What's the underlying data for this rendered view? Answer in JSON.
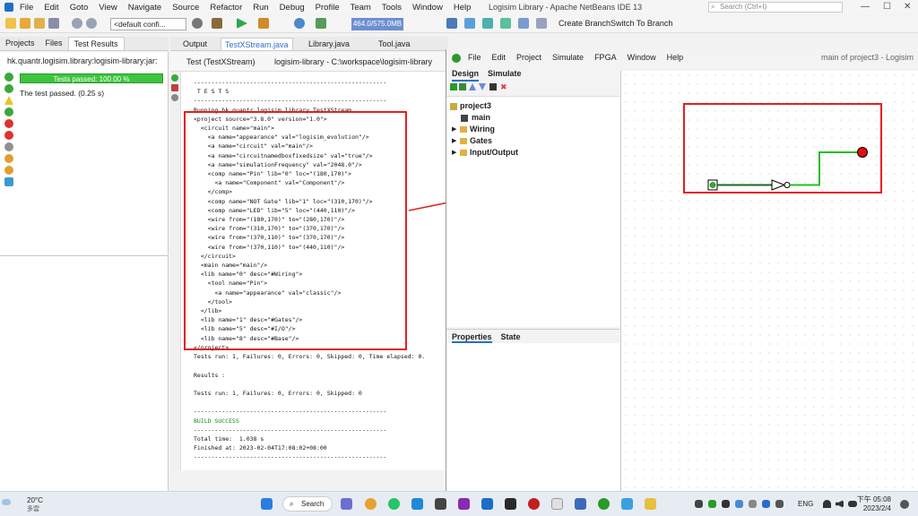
{
  "netbeans": {
    "menu": [
      "File",
      "Edit",
      "Goto",
      "View",
      "Navigate",
      "Source",
      "Refactor",
      "Run",
      "Debug",
      "Profile",
      "Team",
      "Tools",
      "Window",
      "Help"
    ],
    "title": "Logisim Library - Apache NetBeans IDE 13",
    "search_placeholder": "Search (Ctrl+I)",
    "config": "<default confi...",
    "memory": "464.0/575.0MB",
    "create_branch": "Create Branch",
    "switch_branch": "Switch To Branch",
    "left_tabs": [
      "Projects",
      "Files",
      "Test Results"
    ],
    "test_path": "hk.quantr.logisim.library:logisim-library:jar:",
    "progress_text": "Tests passed: 100.00 %",
    "passed_text": "The test passed. (0.25 s)",
    "editor_tabs": [
      "Output",
      "TestXStream.java",
      "Library.java",
      "Tool.java"
    ],
    "output_tabs": [
      "Test (TestXStream)",
      "logisim-library - C:\\workspace\\logisim-library"
    ],
    "output_lines": [
      "-------------------------------------------------------",
      " T E S T S",
      "-------------------------------------------------------",
      "Running hk.quantr.logisim.library.TestXStream",
      "<project source=\"3.8.0\" version=\"1.0\">",
      "  <circuit name=\"main\">",
      "    <a name=\"appearance\" val=\"logisim_evolution\"/>",
      "    <a name=\"circuit\" val=\"main\"/>",
      "    <a name=\"circuitnamedboxfixedsize\" val=\"true\"/>",
      "    <a name=\"simulationFrequency\" val=\"2048.0\"/>",
      "    <comp name=\"Pin\" lib=\"0\" loc=\"(180,170)\">",
      "      <a name=\"Component\" val=\"Component\"/>",
      "    </comp>",
      "    <comp name=\"NOT Gate\" lib=\"1\" loc=\"(310,170)\"/>",
      "    <comp name=\"LED\" lib=\"5\" loc=\"(440,110)\"/>",
      "    <wire from=\"(180,170)\" to=\"(280,170)\"/>",
      "    <wire from=\"(310,170)\" to=\"(370,170)\"/>",
      "    <wire from=\"(370,110)\" to=\"(370,170)\"/>",
      "    <wire from=\"(370,110)\" to=\"(440,110)\"/>",
      "  </circuit>",
      "  <main name=\"main\"/>",
      "  <lib name=\"0\" desc=\"#Wiring\">",
      "    <tool name=\"Pin\">",
      "      <a name=\"appearance\" val=\"classic\"/>",
      "    </tool>",
      "  </lib>",
      "  <lib name=\"1\" desc=\"#Gates\"/>",
      "  <lib name=\"5\" desc=\"#I/O\"/>",
      "  <lib name=\"8\" desc=\"#Base\"/>",
      "</project>",
      "Tests run: 1, Failures: 0, Errors: 0, Skipped: 0, Time elapsed: 0.",
      "",
      "Results :",
      "",
      "Tests run: 1, Failures: 0, Errors: 0, Skipped: 0",
      "",
      "-------------------------------------------------------",
      "BUILD SUCCESS",
      "-------------------------------------------------------",
      "Total time:  1.038 s",
      "Finished at: 2023-02-04T17:08:02+08:00",
      "-------------------------------------------------------"
    ]
  },
  "logisim": {
    "menu": [
      "File",
      "Edit",
      "Project",
      "Simulate",
      "FPGA",
      "Window",
      "Help"
    ],
    "title": "main of project3 - Logisim",
    "tabs": [
      "Design",
      "Simulate"
    ],
    "tree": [
      "project3",
      "main",
      "Wiring",
      "Gates",
      "Input/Output"
    ],
    "props_tabs": [
      "Properties",
      "State"
    ]
  },
  "taskbar": {
    "weather_temp": "20°C",
    "weather_desc": "多雲",
    "search": "Search",
    "lang": "ENG",
    "time": "下午 05:08",
    "date": "2023/2/4"
  },
  "colors": {
    "highlight": "#e02222",
    "progress": "#3ec43e",
    "wire": "#1fbf1f"
  }
}
